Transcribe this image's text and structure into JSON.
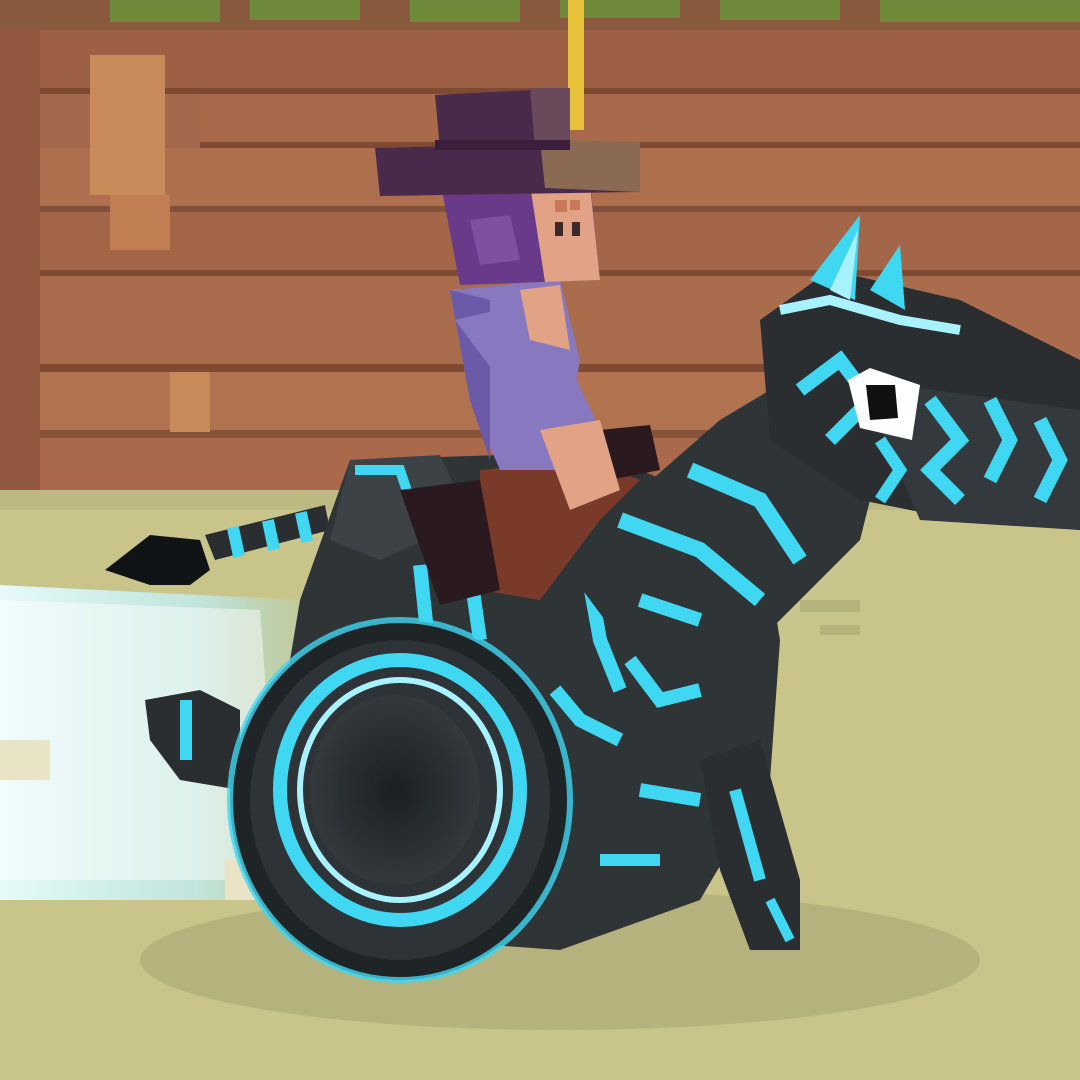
{
  "scene": {
    "description_kind": "game-screenshot",
    "has_hud": false,
    "colors": {
      "sky_wall": "#a4684c",
      "wall_dark": "#8a5038",
      "wall_light": "#c98a5a",
      "ground": "#c8c48a",
      "ground_shadow": "#a9a676",
      "grass_top": "#6e8a3a",
      "zebra_body": "#2a2e30",
      "zebra_body_light": "#3c4245",
      "zebra_glow": "#3fd7f2",
      "zebra_glow_soft": "#a8f1ff",
      "boost_trail": "#d8fbff",
      "hat": "#4a2a4a",
      "hat_band": "#8a6a52",
      "hair": "#6a3a8a",
      "shirt": "#8878c0",
      "skin": "#e2a286",
      "pants": "#7a3a2a",
      "boot": "#2a1a20",
      "rope": "#e8c23a"
    },
    "icons": [
      "player-character-icon",
      "zebra-mount-icon",
      "wheel-icon",
      "boost-trail-icon"
    ]
  }
}
